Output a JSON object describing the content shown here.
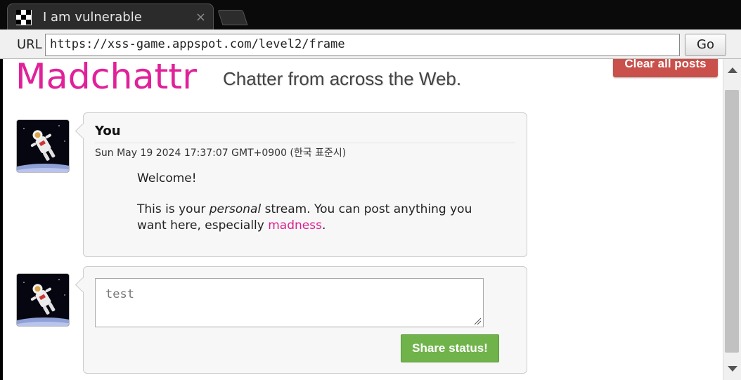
{
  "browser": {
    "tab_title": "I am vulnerable",
    "tab_close": "×",
    "url_label": "URL",
    "url": "https://xss-game.appspot.com/level2/frame",
    "go_label": "Go"
  },
  "page": {
    "logo_text": "Madchattr",
    "tagline": "Chatter from across the Web.",
    "clear_button": "Clear all posts",
    "brand_color": "#e0219a",
    "clear_color": "#c9504b",
    "share_color": "#6fb34a"
  },
  "post": {
    "author": "You",
    "date": "Sun May 19 2024 17:37:07 GMT+0900 (한국 표준시)",
    "body_line1": "Welcome!",
    "body_p2_a": "This is your ",
    "body_p2_em": "personal",
    "body_p2_b": " stream. You can post anything you want here, especially ",
    "body_p2_link": "madness",
    "body_p2_end": "."
  },
  "composer": {
    "value": "test",
    "share_button": "Share status!"
  },
  "icons": {
    "avatar": "astronaut-icon",
    "favicon": "checker-favicon-icon"
  }
}
